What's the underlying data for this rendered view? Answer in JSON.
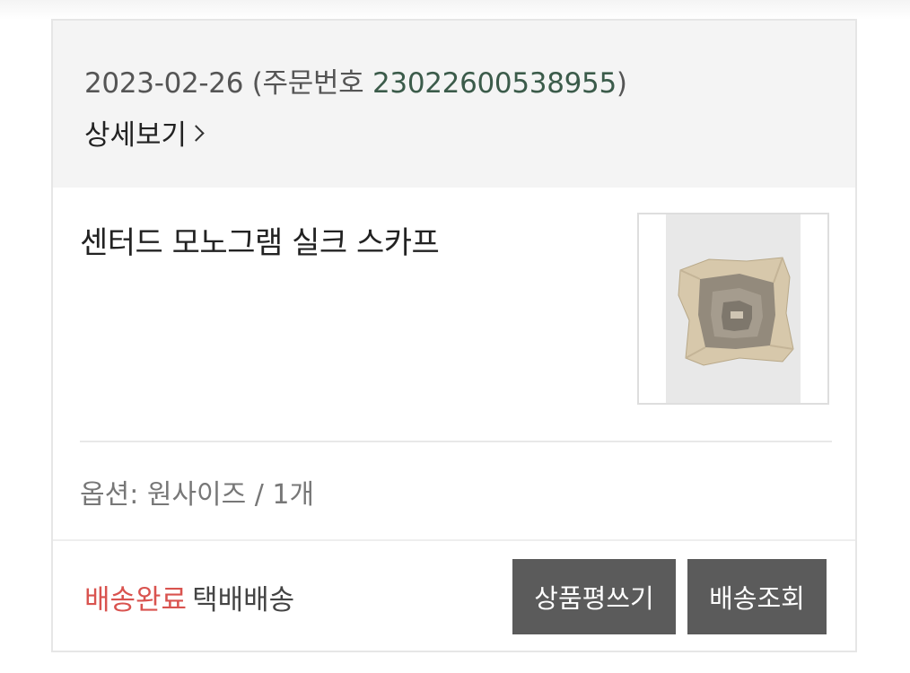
{
  "order": {
    "date": "2023-02-26",
    "number_prefix": " (주문번호 ",
    "number": "23022600538955",
    "number_suffix": ")",
    "detail_label": "상세보기"
  },
  "product": {
    "name": "센터드 모노그램 실크 스카프",
    "thumbnail_icon": "scarf-image",
    "option_label": "옵션: 원사이즈 /  1개"
  },
  "shipping": {
    "status": "배송완료",
    "method": "택배배송"
  },
  "actions": {
    "review_label": "상품평쓰기",
    "track_label": "배송조회"
  },
  "colors": {
    "status_done": "#d9534f",
    "order_number": "#3b5b4a",
    "button_bg": "#5b5b5b"
  }
}
